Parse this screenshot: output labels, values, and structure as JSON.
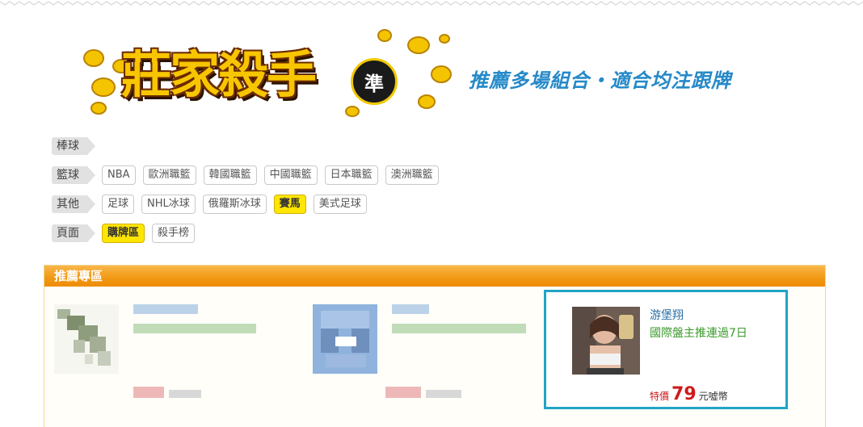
{
  "logo": {
    "title": "莊家殺手",
    "badge": "準"
  },
  "slogan": "推薦多場組合・適合均注跟牌",
  "category_rows": [
    {
      "label": "棒球",
      "tags": []
    },
    {
      "label": "籃球",
      "tags": [
        "NBA",
        "歐洲職籃",
        "韓國職籃",
        "中國職籃",
        "日本職籃",
        "澳洲職籃"
      ]
    },
    {
      "label": "其他",
      "tags": [
        "足球",
        "NHL冰球",
        "俄羅斯冰球",
        "賽馬",
        "美式足球"
      ],
      "active": "賽馬"
    },
    {
      "label": "頁面",
      "tags": [
        "購牌區",
        "殺手榜"
      ],
      "active": "購牌區"
    }
  ],
  "panel": {
    "title": "推薦專區",
    "featured": {
      "name": "游堡翔",
      "description": "國際盤主推連過7日",
      "price_label": "特價",
      "price": "79",
      "price_unit": "元噓幣"
    }
  },
  "colors": {
    "header_orange": "#f29a16",
    "active_tag": "#ffe600",
    "slogan_blue": "#2589c8",
    "featured_border": "#21a4c6",
    "price_red": "#d01a1a"
  }
}
